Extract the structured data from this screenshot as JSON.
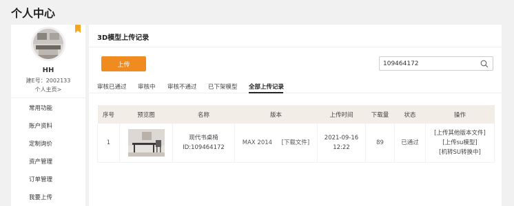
{
  "page": {
    "title": "个人中心"
  },
  "user": {
    "name": "HH",
    "id_text": "建E号：2002133",
    "home_link": "个人主页>"
  },
  "sidebar": {
    "items": [
      {
        "label": "常用功能"
      },
      {
        "label": "账户资料"
      },
      {
        "label": "定制询价"
      },
      {
        "label": "资产管理"
      },
      {
        "label": "订单管理"
      },
      {
        "label": "我要上传"
      }
    ]
  },
  "main": {
    "header": "3D模型上传记录",
    "upload_button": "上传",
    "search": {
      "value": "109464172",
      "placeholder": ""
    },
    "tabs": [
      {
        "label": "审核已通过"
      },
      {
        "label": "审核中"
      },
      {
        "label": "审核不通过"
      },
      {
        "label": "已下架模型"
      },
      {
        "label": "全部上传记录",
        "active": true
      }
    ]
  },
  "table": {
    "columns": [
      "序号",
      "预览图",
      "名称",
      "版本",
      "上传时间",
      "下载量",
      "状态",
      "操作"
    ],
    "rows": [
      {
        "index": "1",
        "name": "现代书桌椅",
        "model_id": "ID:109464172",
        "version": "MAX 2014",
        "download_file": "[下载文件]",
        "upload_date": "2021-09-16",
        "upload_time": "12:22",
        "downloads": "89",
        "status": "已通过",
        "actions": [
          "[上传其他版本文件]",
          "[上传su模型]",
          "[机转SU转换中]"
        ]
      }
    ]
  },
  "colors": {
    "accent": "#f08c1f",
    "bookmark": "#f5a623",
    "table_header": "#f2ede6"
  }
}
